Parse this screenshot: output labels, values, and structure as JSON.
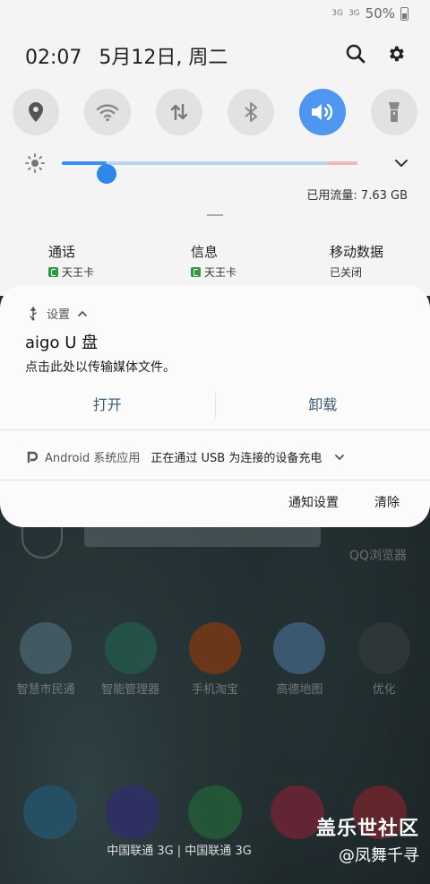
{
  "status_bar": {
    "battery": "50%",
    "signal1": "3G",
    "signal2": "3G"
  },
  "header": {
    "time": "02:07",
    "date": "5月12日, 周二"
  },
  "quick_settings": [
    "location-icon",
    "wifi-icon",
    "data-transfer-icon",
    "bluetooth-icon",
    "sound-icon",
    "flashlight-icon"
  ],
  "brightness": {
    "level": 0.15
  },
  "data_usage": "已用流量: 7.63 GB",
  "sims": [
    {
      "title": "通话",
      "sub": "天王卡"
    },
    {
      "title": "信息",
      "sub": "天王卡"
    },
    {
      "title": "移动数据",
      "sub": "已关闭"
    }
  ],
  "notification1": {
    "app": "设置",
    "title": "aigo U 盘",
    "body": "点击此处以传输媒体文件。",
    "action_open": "打开",
    "action_uninstall": "卸载"
  },
  "notification2": {
    "app": "Android 系统应用",
    "text": "正在通过 USB 为连接的设备充电"
  },
  "actions": {
    "notif_settings": "通知设置",
    "clear": "清除"
  },
  "home": {
    "qq_browser": "QQ浏览器",
    "apps": [
      "智慧市民通",
      "智能管理器",
      "手机淘宝",
      "高德地图",
      "优化"
    ],
    "carrier": "中国联通 3G | 中国联通 3G",
    "watermark1": "盖乐世社区",
    "watermark2": "@凤舞千寻"
  },
  "colors": {
    "accent": "#4e96f0",
    "shade_bg": "#f4f4f4",
    "card_bg": "#fbfbfb"
  }
}
